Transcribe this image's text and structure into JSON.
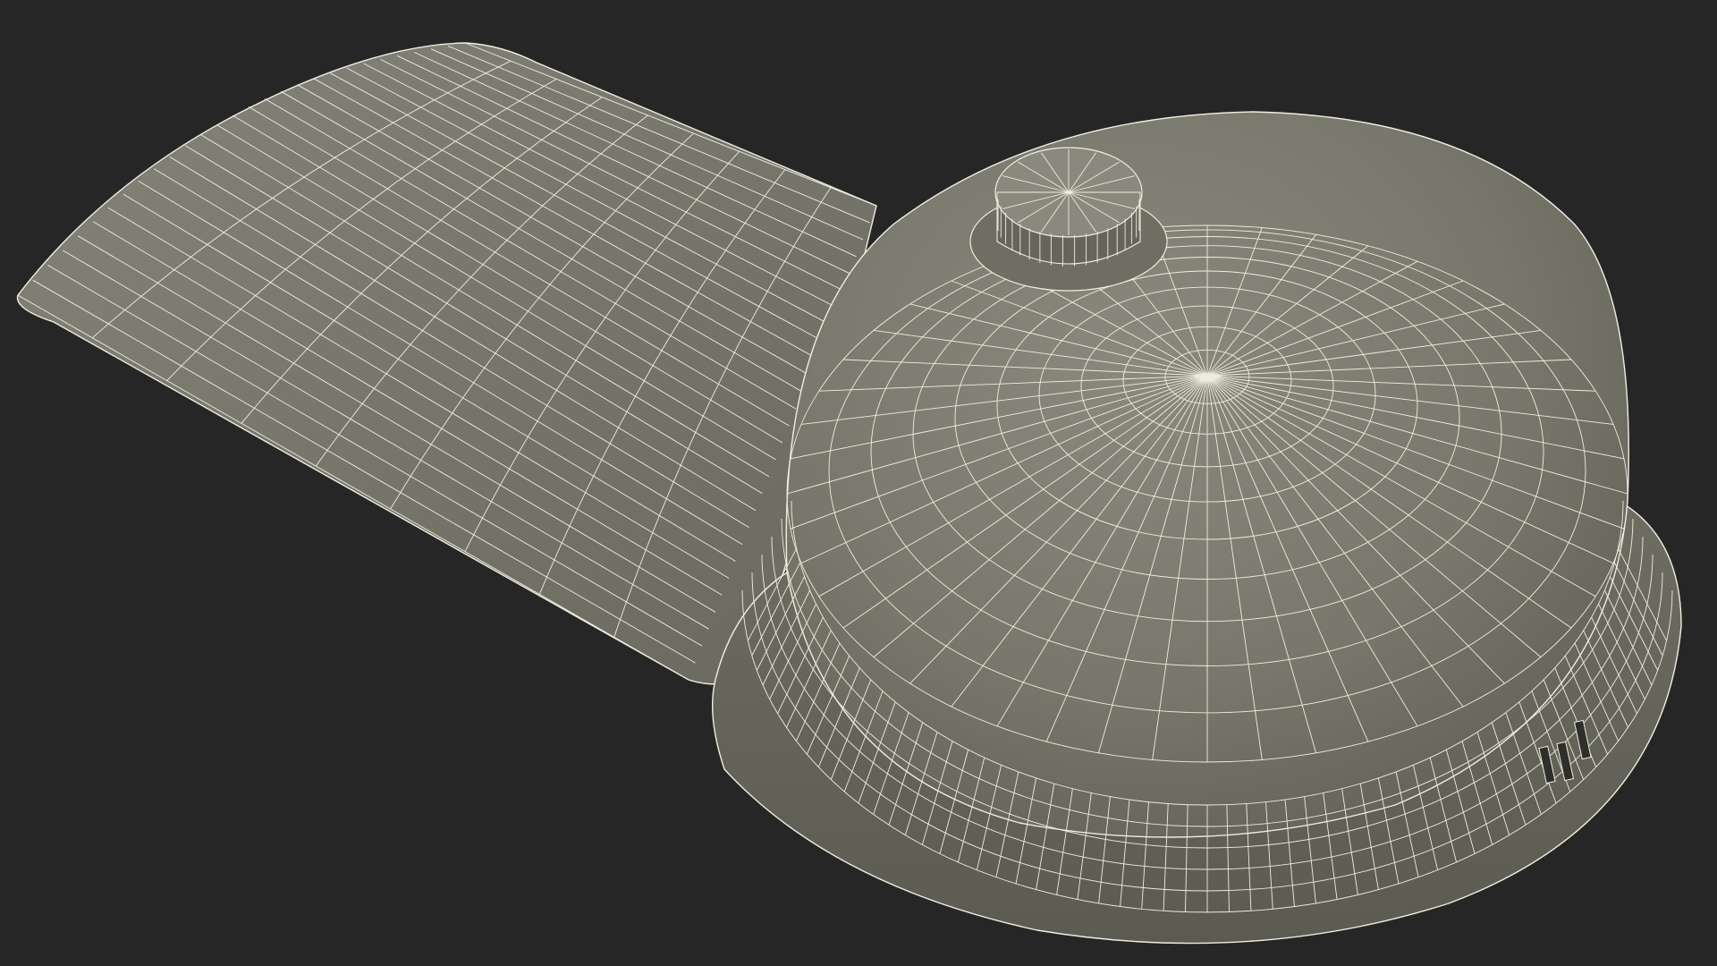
{
  "scene": {
    "background": "#262626",
    "surface_color": "#7a7a6e",
    "surface_shadow": "#5f5f56",
    "surface_highlight": "#8c8c80",
    "wire_color": "#efeee0",
    "object": "3d-wireframe-mesh-cap-with-flap"
  }
}
